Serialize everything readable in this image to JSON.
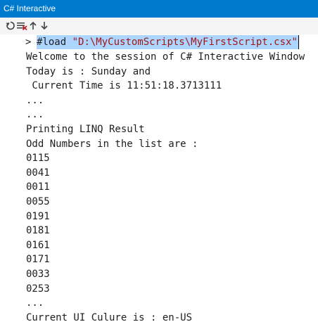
{
  "window": {
    "title": "C# Interactive"
  },
  "toolbar": {
    "reset_icon": "reset-icon",
    "clear_icon": "clear-screen-icon",
    "history_up_icon": "arrow-up-icon",
    "history_down_icon": "arrow-down-icon"
  },
  "input": {
    "prompt": ">",
    "keyword": "#load",
    "argument": "\"D:\\MyCustomScripts\\MyFirstScript.csx\""
  },
  "output_lines": [
    "Welcome to the session of C# Interactive Window",
    "Today is : Sunday and",
    " Current Time is 11:51:18.3713111",
    "...",
    "...",
    "Printing LINQ Result",
    "Odd Numbers in the list are :",
    "0115",
    "0041",
    "0011",
    "0055",
    "0191",
    "0181",
    "0161",
    "0171",
    "0033",
    "0253",
    "...",
    "Current UI Culure is : en-US"
  ],
  "colors": {
    "titlebar": "#007acc",
    "selection": "#add6ff",
    "string": "#a31515"
  }
}
